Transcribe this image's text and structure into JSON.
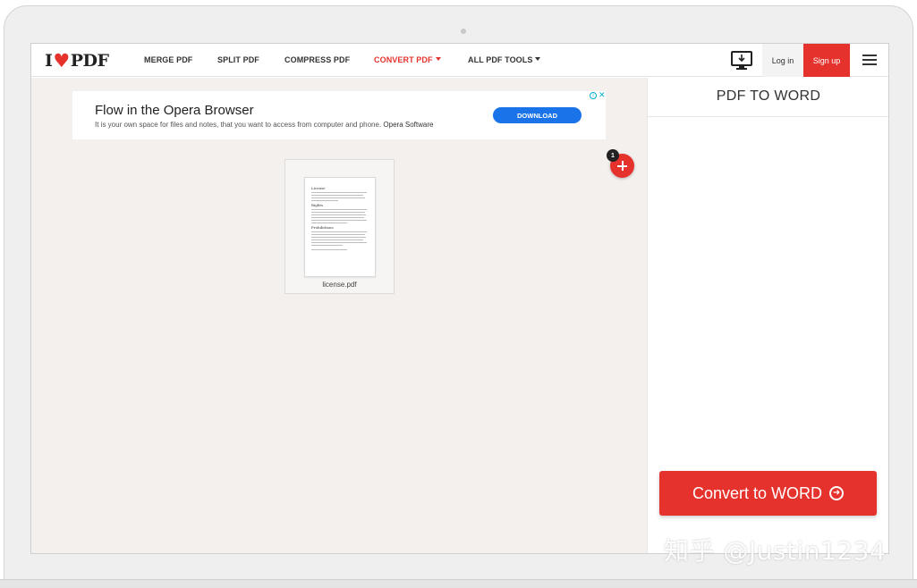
{
  "brand": {
    "logo_prefix": "I",
    "logo_suffix": "PDF",
    "accent_color": "#e5322d"
  },
  "nav": {
    "items": [
      {
        "label": "MERGE PDF"
      },
      {
        "label": "SPLIT PDF"
      },
      {
        "label": "COMPRESS PDF"
      },
      {
        "label": "CONVERT PDF"
      },
      {
        "label": "ALL PDF TOOLS"
      }
    ],
    "login_label": "Log in",
    "signup_label": "Sign up",
    "desktop_icon": "desktop-monitor-icon",
    "menu_icon": "hamburger-menu-icon"
  },
  "ad": {
    "title": "Flow in the Opera Browser",
    "text": "It is your own space for files and notes, that you want to access from computer and phone.",
    "advertiser": "Opera Software",
    "button_label": "DOWNLOAD",
    "info_icon": "info-icon",
    "close_icon": "close-icon"
  },
  "workspace": {
    "files": [
      {
        "name": "license.pdf"
      }
    ],
    "file_count": "1",
    "add_icon": "plus-icon",
    "preview": {
      "heading_1": "License",
      "heading_2": "Rights",
      "heading_3": "Prohibitions"
    }
  },
  "panel": {
    "title": "PDF TO WORD",
    "convert_label": "Convert to WORD",
    "convert_icon": "arrow-right-circle-icon"
  },
  "watermark": "知乎 @Justin1234"
}
